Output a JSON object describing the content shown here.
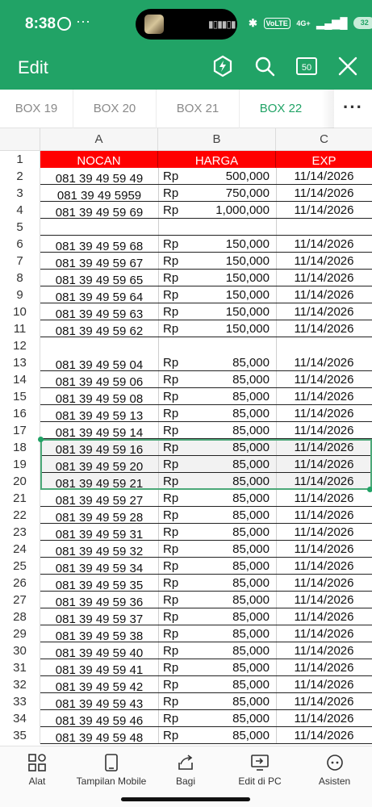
{
  "status_bar": {
    "time": "8:38",
    "more": "···",
    "network": "4G+",
    "volte": "VoLTE",
    "battery": "32"
  },
  "header": {
    "title": "Edit",
    "edit_box_label": "50"
  },
  "tabs": [
    {
      "label": "BOX 19",
      "active": false
    },
    {
      "label": "BOX 20",
      "active": false
    },
    {
      "label": "BOX 21",
      "active": false
    },
    {
      "label": "BOX 22",
      "active": true
    }
  ],
  "tabs_more": "···",
  "sheet": {
    "columns": [
      "A",
      "B",
      "C"
    ],
    "header_row": {
      "row": "1",
      "a": "NOCAN",
      "b": "HARGA",
      "c": "EXP",
      "color": "#ff0000"
    },
    "selected_rows": [
      "18",
      "19",
      "20"
    ],
    "rows": [
      {
        "row": "2",
        "nocan": "081 39 49 59 49",
        "cur": "Rp",
        "harga": "500,000",
        "exp": "11/14/2026"
      },
      {
        "row": "3",
        "nocan": "081 39 49 5959",
        "cur": "Rp",
        "harga": "750,000",
        "exp": "11/14/2026"
      },
      {
        "row": "4",
        "nocan": "081 39 49 59 69",
        "cur": "Rp",
        "harga": "1,000,000",
        "exp": "11/14/2026"
      },
      {
        "row": "5",
        "nocan": "",
        "cur": "",
        "harga": "",
        "exp": ""
      },
      {
        "row": "6",
        "nocan": "081 39 49 59 68",
        "cur": "Rp",
        "harga": "150,000",
        "exp": "11/14/2026"
      },
      {
        "row": "7",
        "nocan": "081 39 49 59 67",
        "cur": "Rp",
        "harga": "150,000",
        "exp": "11/14/2026"
      },
      {
        "row": "8",
        "nocan": "081 39 49 59 65",
        "cur": "Rp",
        "harga": "150,000",
        "exp": "11/14/2026"
      },
      {
        "row": "9",
        "nocan": "081 39 49 59 64",
        "cur": "Rp",
        "harga": "150,000",
        "exp": "11/14/2026"
      },
      {
        "row": "10",
        "nocan": "081 39 49 59 63",
        "cur": "Rp",
        "harga": "150,000",
        "exp": "11/14/2026"
      },
      {
        "row": "11",
        "nocan": "081 39 49 59 62",
        "cur": "Rp",
        "harga": "150,000",
        "exp": "11/14/2026"
      },
      {
        "row": "12",
        "nocan": "",
        "cur": "",
        "harga": "",
        "exp": ""
      },
      {
        "row": "13",
        "nocan": "081 39 49 59 04",
        "cur": "Rp",
        "harga": "85,000",
        "exp": "11/14/2026"
      },
      {
        "row": "14",
        "nocan": "081 39 49 59 06",
        "cur": "Rp",
        "harga": "85,000",
        "exp": "11/14/2026"
      },
      {
        "row": "15",
        "nocan": "081 39 49 59 08",
        "cur": "Rp",
        "harga": "85,000",
        "exp": "11/14/2026"
      },
      {
        "row": "16",
        "nocan": "081 39 49 59 13",
        "cur": "Rp",
        "harga": "85,000",
        "exp": "11/14/2026"
      },
      {
        "row": "17",
        "nocan": "081 39 49 59 14",
        "cur": "Rp",
        "harga": "85,000",
        "exp": "11/14/2026"
      },
      {
        "row": "18",
        "nocan": "081 39 49 59 16",
        "cur": "Rp",
        "harga": "85,000",
        "exp": "11/14/2026"
      },
      {
        "row": "19",
        "nocan": "081 39 49 59 20",
        "cur": "Rp",
        "harga": "85,000",
        "exp": "11/14/2026"
      },
      {
        "row": "20",
        "nocan": "081 39 49 59 21",
        "cur": "Rp",
        "harga": "85,000",
        "exp": "11/14/2026"
      },
      {
        "row": "21",
        "nocan": "081 39 49 59 27",
        "cur": "Rp",
        "harga": "85,000",
        "exp": "11/14/2026"
      },
      {
        "row": "22",
        "nocan": "081 39 49 59 28",
        "cur": "Rp",
        "harga": "85,000",
        "exp": "11/14/2026"
      },
      {
        "row": "23",
        "nocan": "081 39 49 59 31",
        "cur": "Rp",
        "harga": "85,000",
        "exp": "11/14/2026"
      },
      {
        "row": "24",
        "nocan": "081 39 49 59 32",
        "cur": "Rp",
        "harga": "85,000",
        "exp": "11/14/2026"
      },
      {
        "row": "25",
        "nocan": "081 39 49 59 34",
        "cur": "Rp",
        "harga": "85,000",
        "exp": "11/14/2026"
      },
      {
        "row": "26",
        "nocan": "081 39 49 59 35",
        "cur": "Rp",
        "harga": "85,000",
        "exp": "11/14/2026"
      },
      {
        "row": "27",
        "nocan": "081 39 49 59 36",
        "cur": "Rp",
        "harga": "85,000",
        "exp": "11/14/2026"
      },
      {
        "row": "28",
        "nocan": "081 39 49 59 37",
        "cur": "Rp",
        "harga": "85,000",
        "exp": "11/14/2026"
      },
      {
        "row": "29",
        "nocan": "081 39 49 59 38",
        "cur": "Rp",
        "harga": "85,000",
        "exp": "11/14/2026"
      },
      {
        "row": "30",
        "nocan": "081 39 49 59 40",
        "cur": "Rp",
        "harga": "85,000",
        "exp": "11/14/2026"
      },
      {
        "row": "31",
        "nocan": "081 39 49 59 41",
        "cur": "Rp",
        "harga": "85,000",
        "exp": "11/14/2026"
      },
      {
        "row": "32",
        "nocan": "081 39 49 59 42",
        "cur": "Rp",
        "harga": "85,000",
        "exp": "11/14/2026"
      },
      {
        "row": "33",
        "nocan": "081 39 49 59 43",
        "cur": "Rp",
        "harga": "85,000",
        "exp": "11/14/2026"
      },
      {
        "row": "34",
        "nocan": "081 39 49 59 46",
        "cur": "Rp",
        "harga": "85,000",
        "exp": "11/14/2026"
      },
      {
        "row": "35",
        "nocan": "081 39 49 59 48",
        "cur": "Rp",
        "harga": "85,000",
        "exp": "11/14/2026"
      }
    ]
  },
  "toolbar": {
    "items": [
      {
        "label": "Alat",
        "icon": "tools-grid-icon"
      },
      {
        "label": "Tampilan Mobile",
        "icon": "mobile-view-icon"
      },
      {
        "label": "Bagi",
        "icon": "share-icon"
      },
      {
        "label": "Edit di PC",
        "icon": "edit-on-pc-icon"
      },
      {
        "label": "Asisten",
        "icon": "assistant-icon"
      }
    ]
  },
  "colors": {
    "brand": "#21a366",
    "header_fill": "#ff0000",
    "selection": "#4ca878"
  }
}
